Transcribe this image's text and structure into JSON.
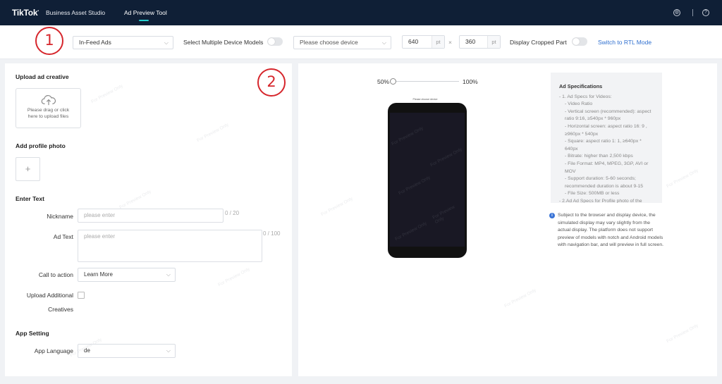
{
  "header": {
    "logo": "TikTok",
    "logo_dot": "•",
    "brand_title": "Business Asset Studio",
    "nav_tab": "Ad Preview Tool",
    "icons": [
      "language-icon",
      "help-icon"
    ]
  },
  "toolbar": {
    "ad_type": "In-Feed Ads",
    "multi_device_label": "Select Multiple Device Models",
    "device_placeholder": "Please choose device",
    "width": "640",
    "height": "360",
    "unit": "pt",
    "times": "×",
    "crop_label": "Display Cropped Part",
    "rtl_link": "Switch to RTL Mode"
  },
  "annotations": [
    "1",
    "2"
  ],
  "left": {
    "upload_title": "Upload ad creative",
    "upload_text": "Please drag or click here to upload files",
    "profile_title": "Add profile photo",
    "plus": "+",
    "text_title": "Enter Text",
    "nickname_label": "Nickname",
    "nickname_placeholder": "please enter",
    "nickname_count": "0 / 20",
    "adtext_label": "Ad Text",
    "adtext_placeholder": "please enter",
    "adtext_count": "0 / 100",
    "cta_label": "Call to action",
    "cta_value": "Learn More",
    "additional_label_1": "Upload Additional",
    "additional_label_2": "Creatives",
    "app_title": "App Setting",
    "lang_label": "App Language",
    "lang_value": "de"
  },
  "preview": {
    "zoom_min": "50%",
    "zoom_max": "100%",
    "zoom_fraction": 0,
    "notch_text": "Please choose device"
  },
  "spec": {
    "title": "Ad Specifications",
    "lines": [
      {
        "t": "- 1. Ad Specs for Videos:",
        "lvl": 1
      },
      {
        "t": "- Video Ratio",
        "lvl": 2
      },
      {
        "t": "- Vertical screen (recommended): aspect ratio 9:16, ≥540px * 960px",
        "lvl": 2
      },
      {
        "t": "- Horizontal screen: aspect ratio 16: 9 , ≥960px * 540px",
        "lvl": 2
      },
      {
        "t": "- Square: aspect ratio 1: 1, ≥640px * 640px",
        "lvl": 2
      },
      {
        "t": "- Bitrate: higher than 2,500 kbps",
        "lvl": 2
      },
      {
        "t": "- File Format: MP4, MPEG, 3GP, AVI or MOV",
        "lvl": 2
      },
      {
        "t": "- Support duration: 5-60 seconds; recommended duration is about 9-15",
        "lvl": 2
      },
      {
        "t": "- File Size: 500MB or less",
        "lvl": 2
      },
      {
        "t": "- 2.Ad Ad Specs for Profile photo of the",
        "lvl": 1
      }
    ],
    "notice": "Subject to the browser and display device, the simulated display may vary slightly from the actual display. The platform does not support preview of models with notch and Android models with navigation bar, and will preview in full screen."
  },
  "watermark": "For Preview Only",
  "colors": {
    "header_bg": "#0f1f36",
    "accent": "#25d0cf",
    "link": "#2f6fcf",
    "annotation": "#d6262c"
  }
}
